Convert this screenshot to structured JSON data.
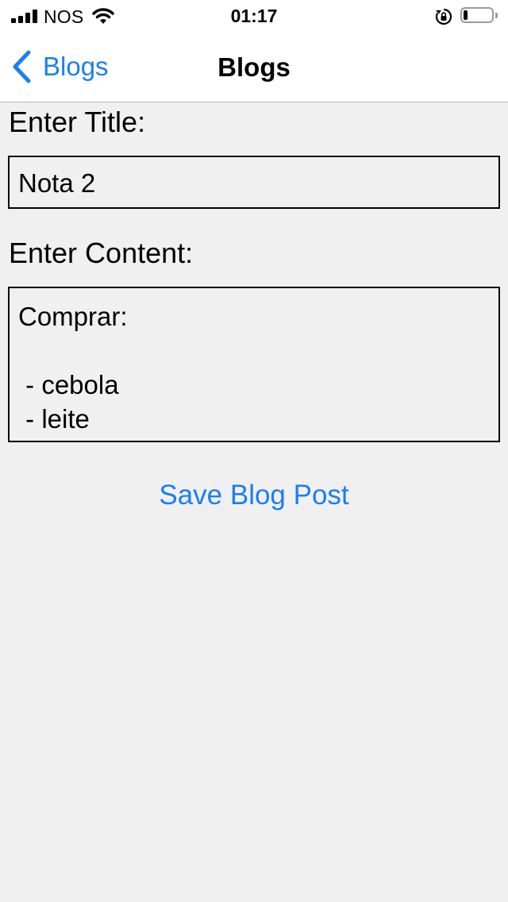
{
  "status_bar": {
    "carrier": "NOS",
    "time": "01:17",
    "battery_level": 0.15
  },
  "nav": {
    "back_label": "Blogs",
    "title": "Blogs"
  },
  "form": {
    "title_label": "Enter Title:",
    "title_value": "Nota 2",
    "content_label": "Enter Content:",
    "content_value": "Comprar:\n\n - cebola\n - leite",
    "save_label": "Save Blog Post"
  },
  "colors": {
    "accent": "#1a7ff0",
    "background": "#f0f0f0"
  }
}
